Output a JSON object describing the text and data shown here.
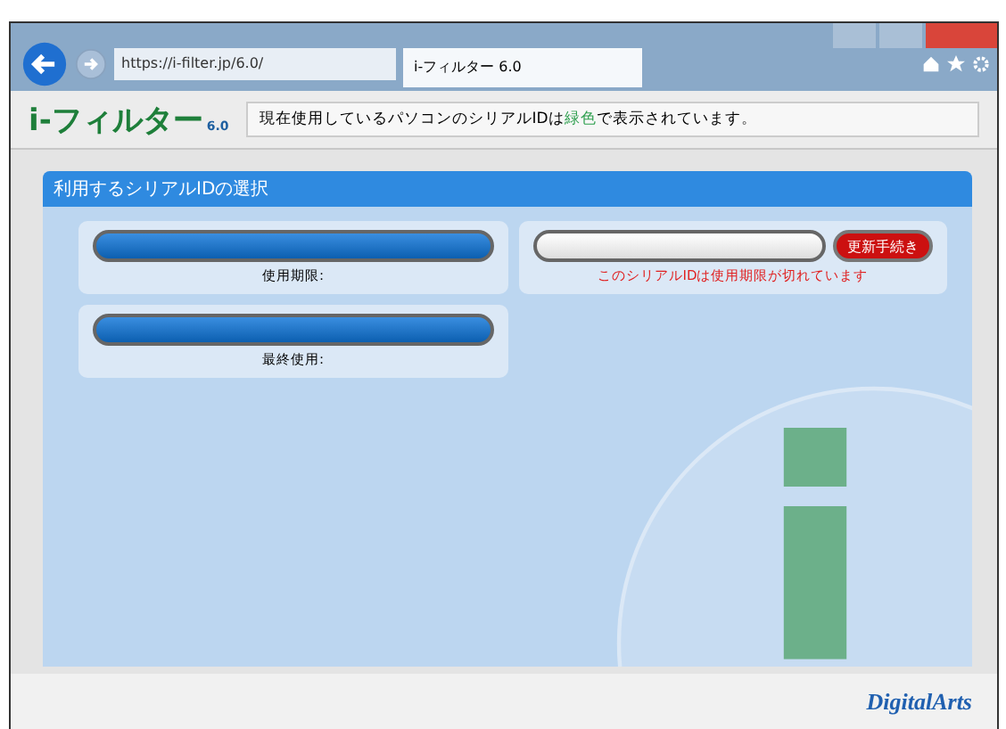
{
  "browser": {
    "address": "https://i-filter.jp/6.0/",
    "tab_title": "i-フィルター 6.0"
  },
  "header": {
    "logo": "i-フィルター",
    "logo_version": "6.0",
    "message_parts": [
      {
        "text": "現在使用しているパソコンのシリアルIDは",
        "highlight": false
      },
      {
        "text": "緑色",
        "highlight": true
      },
      {
        "text": "で表示されています。",
        "highlight": false
      }
    ]
  },
  "panel": {
    "title": "利用するシリアルIDの選択"
  },
  "serials": [
    {
      "kind": "active",
      "caption": "使用期限:"
    },
    {
      "kind": "expired",
      "action": "更新手続き",
      "note": "このシリアルIDは使用期限が切れています"
    },
    {
      "kind": "active",
      "caption": "最終使用:"
    }
  ],
  "footer": {
    "brand": "DigitalArts"
  }
}
